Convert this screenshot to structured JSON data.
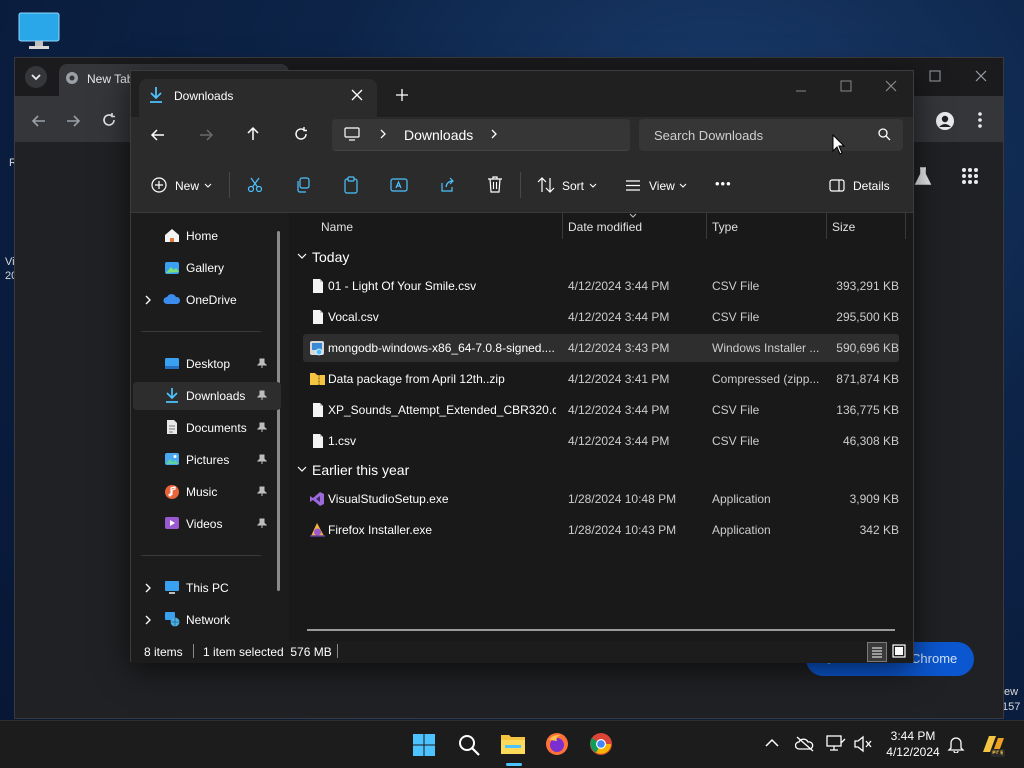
{
  "desktop": {
    "fragments": [
      "R",
      "Vi",
      "20",
      "ew",
      "157"
    ]
  },
  "chrome": {
    "tab_title": "New Tab",
    "customize_label": "Customize Chrome"
  },
  "explorer": {
    "tab_title": "Downloads",
    "breadcrumb": [
      "Downloads"
    ],
    "search_placeholder": "Search Downloads",
    "commands": {
      "new": "New",
      "sort": "Sort",
      "view": "View",
      "more": "•••",
      "details": "Details"
    },
    "nav": {
      "top": [
        "Home",
        "Gallery",
        "OneDrive"
      ],
      "pinned": [
        "Desktop",
        "Downloads",
        "Documents",
        "Pictures",
        "Music",
        "Videos"
      ],
      "bottom": [
        "This PC",
        "Network"
      ]
    },
    "columns": [
      "Name",
      "Date modified",
      "Type",
      "Size"
    ],
    "groups": [
      {
        "label": "Today",
        "files": [
          {
            "name": "01 - Light Of Your Smile.csv",
            "date": "4/12/2024 3:44 PM",
            "type": "CSV File",
            "size": "393,291 KB"
          },
          {
            "name": "Vocal.csv",
            "date": "4/12/2024 3:44 PM",
            "type": "CSV File",
            "size": "295,500 KB"
          },
          {
            "name": "mongodb-windows-x86_64-7.0.8-signed....",
            "date": "4/12/2024 3:43 PM",
            "type": "Windows Installer ...",
            "size": "590,696 KB"
          },
          {
            "name": "Data package from April 12th..zip",
            "date": "4/12/2024 3:41 PM",
            "type": "Compressed (zipp...",
            "size": "871,874 KB"
          },
          {
            "name": "XP_Sounds_Attempt_Extended_CBR320.csv",
            "date": "4/12/2024 3:44 PM",
            "type": "CSV File",
            "size": "136,775 KB"
          },
          {
            "name": "1.csv",
            "date": "4/12/2024 3:44 PM",
            "type": "CSV File",
            "size": "46,308 KB"
          }
        ]
      },
      {
        "label": "Earlier this year",
        "files": [
          {
            "name": "VisualStudioSetup.exe",
            "date": "1/28/2024 10:48 PM",
            "type": "Application",
            "size": "3,909 KB"
          },
          {
            "name": "Firefox Installer.exe",
            "date": "1/28/2024 10:43 PM",
            "type": "Application",
            "size": "342 KB"
          }
        ]
      }
    ],
    "status": {
      "count": "8 items",
      "selection": "1 item selected  576 MB"
    }
  },
  "taskbar": {
    "time": "3:44 PM",
    "date": "4/12/2024"
  },
  "colors": {
    "accent": "#4cc2ff",
    "folder": "#f5c542",
    "onedrive": "#3b8ced",
    "chrome_blue": "#0b57d0"
  }
}
